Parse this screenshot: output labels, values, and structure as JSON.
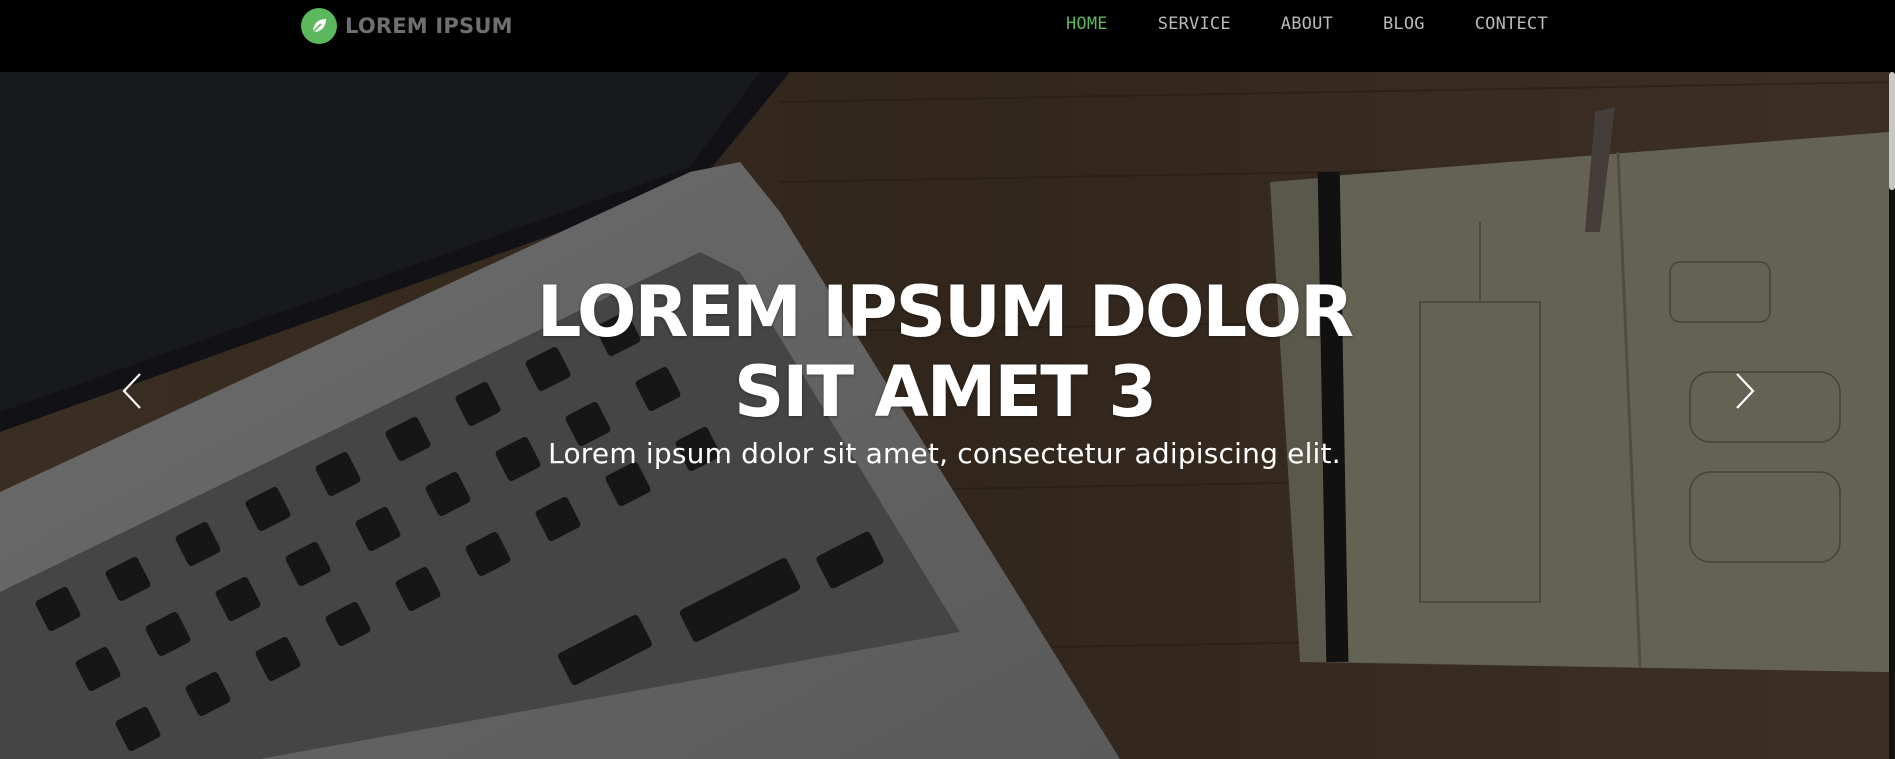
{
  "brand": {
    "name": "LOREM IPSUM",
    "logo_icon": "leaf-icon",
    "logo_color": "#5cb85c"
  },
  "nav": {
    "items": [
      {
        "label": "HOME",
        "active": true
      },
      {
        "label": "SERVICE",
        "active": false
      },
      {
        "label": "ABOUT",
        "active": false
      },
      {
        "label": "BLOG",
        "active": false
      },
      {
        "label": "CONTECT",
        "active": false
      }
    ],
    "active_color": "#5cb85c"
  },
  "hero": {
    "title": "LOREM IPSUM DOLOR SIT AMET 3",
    "subtitle": "Lorem ipsum dolor sit amet, consectetur adipiscing elit.",
    "prev_icon": "chevron-left-icon",
    "next_icon": "chevron-right-icon"
  }
}
